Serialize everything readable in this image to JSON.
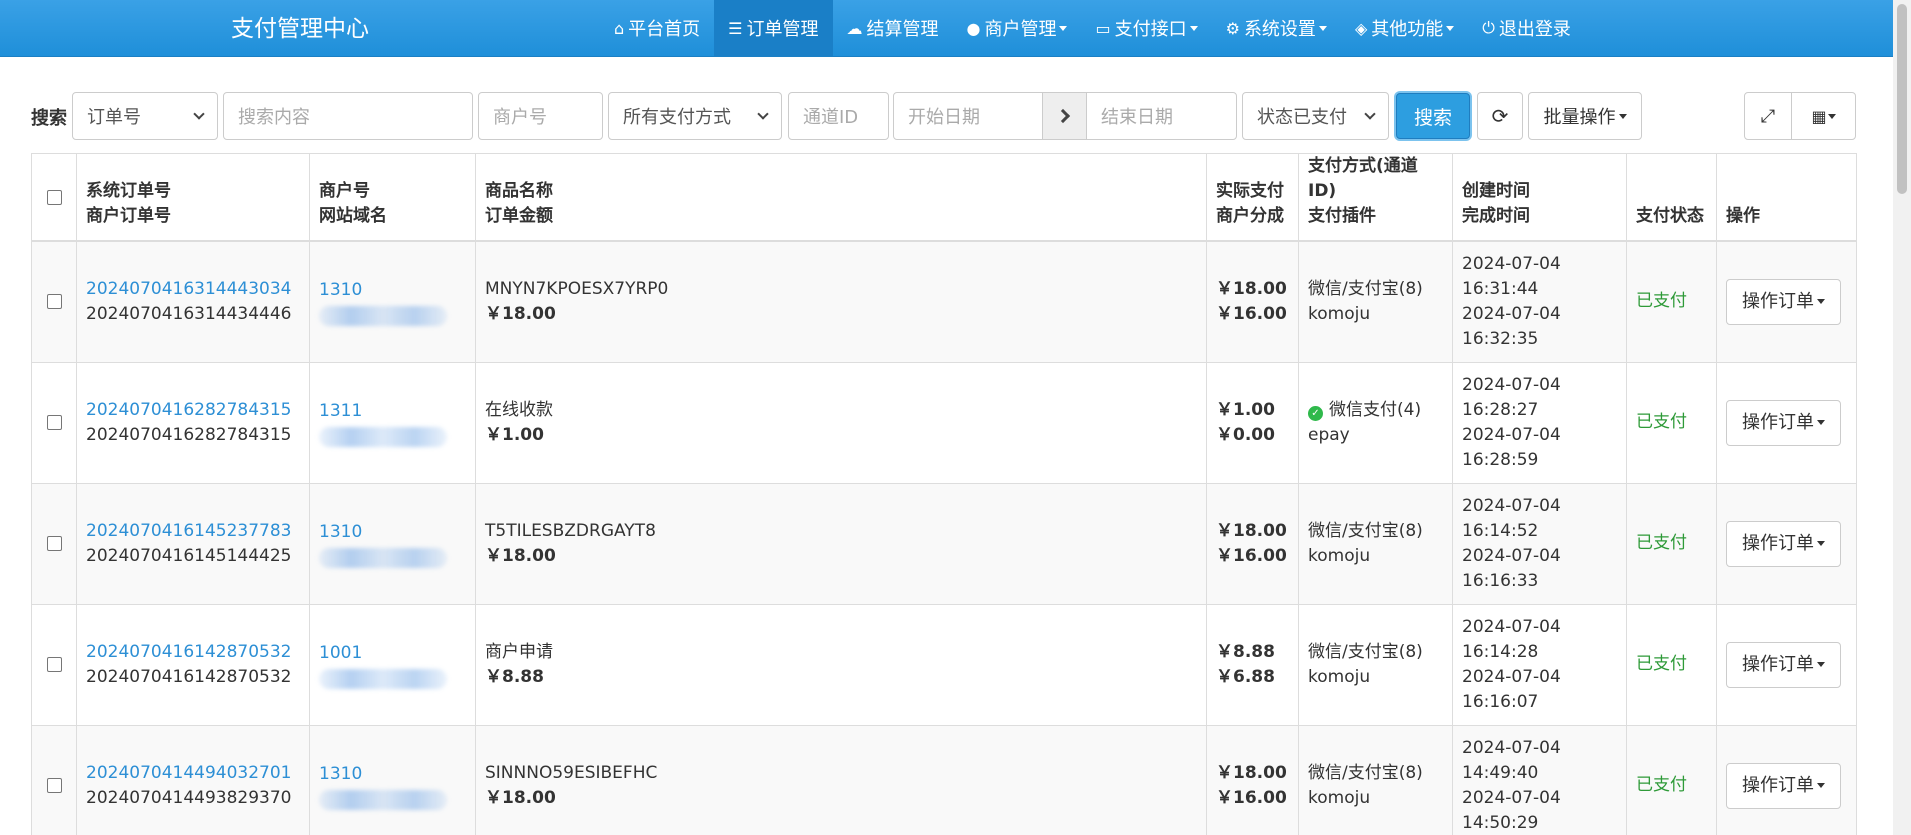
{
  "brand": "支付管理中心",
  "nav": [
    {
      "icon": "home-icon",
      "glyph": "⌂",
      "label": "平台首页",
      "active": false,
      "dropdown": false
    },
    {
      "icon": "list-icon",
      "glyph": "☰",
      "label": "订单管理",
      "active": true,
      "dropdown": false
    },
    {
      "icon": "cloud-icon",
      "glyph": "☁",
      "label": "结算管理",
      "active": false,
      "dropdown": false
    },
    {
      "icon": "user-icon",
      "glyph": "●",
      "label": "商户管理",
      "active": false,
      "dropdown": true
    },
    {
      "icon": "credit-card-icon",
      "glyph": "▭",
      "label": "支付接口",
      "active": false,
      "dropdown": true
    },
    {
      "icon": "gear-icon",
      "glyph": "⚙",
      "label": "系统设置",
      "active": false,
      "dropdown": true
    },
    {
      "icon": "cube-icon",
      "glyph": "◈",
      "label": "其他功能",
      "active": false,
      "dropdown": true
    },
    {
      "icon": "power-icon",
      "glyph": "⏻",
      "label": "退出登录",
      "active": false,
      "dropdown": false
    }
  ],
  "toolbar": {
    "search_label": "搜索",
    "type_select": "订单号",
    "content_placeholder": "搜索内容",
    "merchant_placeholder": "商户号",
    "pay_method_select": "所有支付方式",
    "channel_placeholder": "通道ID",
    "start_date_placeholder": "开始日期",
    "end_date_placeholder": "结束日期",
    "status_select": "状态已支付",
    "search_button": "搜索",
    "batch_button": "批量操作"
  },
  "table": {
    "headers": {
      "order": [
        "系统订单号",
        "商户订单号"
      ],
      "merchant": [
        "商户号",
        "网站域名"
      ],
      "product": [
        "商品名称",
        "订单金额"
      ],
      "amount": [
        "实际支付",
        "商户分成"
      ],
      "method": [
        "支付方式(通道ID)",
        "支付插件"
      ],
      "time": [
        "创建时间",
        "完成时间"
      ],
      "status": "支付状态",
      "action": "操作"
    },
    "rows": [
      {
        "sys_order": "2024070416314443034",
        "mch_order": "2024070416314434446",
        "merchant_id": "1310",
        "product": "MNYN7KPOESX7YRP0",
        "order_amount": "￥18.00",
        "paid": "￥18.00",
        "share": "￥16.00",
        "method": "微信/支付宝(8)",
        "wechat": false,
        "plugin": "komoju",
        "created_date": "2024-07-04",
        "created_time": "16:31:44",
        "done_date": "2024-07-04",
        "done_time": "16:32:35",
        "status": "已支付",
        "op": "操作订单"
      },
      {
        "sys_order": "2024070416282784315",
        "mch_order": "2024070416282784315",
        "merchant_id": "1311",
        "product": "在线收款",
        "order_amount": "￥1.00",
        "paid": "￥1.00",
        "share": "￥0.00",
        "method": "微信支付(4)",
        "wechat": true,
        "plugin": "epay",
        "created_date": "2024-07-04",
        "created_time": "16:28:27",
        "done_date": "2024-07-04",
        "done_time": "16:28:59",
        "status": "已支付",
        "op": "操作订单"
      },
      {
        "sys_order": "2024070416145237783",
        "mch_order": "2024070416145144425",
        "merchant_id": "1310",
        "product": "T5TILESBZDRGAYT8",
        "order_amount": "￥18.00",
        "paid": "￥18.00",
        "share": "￥16.00",
        "method": "微信/支付宝(8)",
        "wechat": false,
        "plugin": "komoju",
        "created_date": "2024-07-04",
        "created_time": "16:14:52",
        "done_date": "2024-07-04",
        "done_time": "16:16:33",
        "status": "已支付",
        "op": "操作订单"
      },
      {
        "sys_order": "2024070416142870532",
        "mch_order": "2024070416142870532",
        "merchant_id": "1001",
        "product": "商户申请",
        "order_amount": "￥8.88",
        "paid": "￥8.88",
        "share": "￥6.88",
        "method": "微信/支付宝(8)",
        "wechat": false,
        "plugin": "komoju",
        "created_date": "2024-07-04",
        "created_time": "16:14:28",
        "done_date": "2024-07-04",
        "done_time": "16:16:07",
        "status": "已支付",
        "op": "操作订单"
      },
      {
        "sys_order": "2024070414494032701",
        "mch_order": "2024070414493829370",
        "merchant_id": "1310",
        "product": "SINNNO59ESIBEFHC",
        "order_amount": "￥18.00",
        "paid": "￥18.00",
        "share": "￥16.00",
        "method": "微信/支付宝(8)",
        "wechat": false,
        "plugin": "komoju",
        "created_date": "2024-07-04",
        "created_time": "14:49:40",
        "done_date": "2024-07-04",
        "done_time": "14:50:29",
        "status": "已支付",
        "op": "操作订单"
      }
    ]
  }
}
